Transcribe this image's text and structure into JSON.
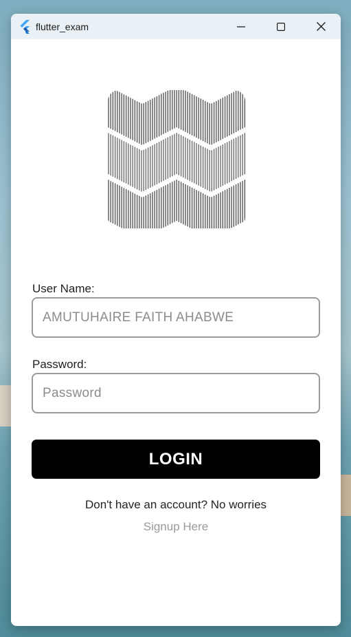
{
  "window": {
    "title": "flutter_exam",
    "icon": "flutter-logo-icon",
    "controls": [
      "minimize-icon",
      "maximize-icon",
      "close-icon"
    ]
  },
  "logo": {
    "icon": "zigzag-pattern-logo"
  },
  "form": {
    "username_label": "User Name:",
    "username_placeholder": "AMUTUHAIRE FAITH AHABWE",
    "username_value": "",
    "password_label": "Password:",
    "password_placeholder": "Password",
    "password_value": "",
    "login_label": "LOGIN"
  },
  "footer": {
    "prompt": "Don't have an account? No worries",
    "signup_link": "Signup Here"
  },
  "colors": {
    "titlebar": "#e9f1f6",
    "button": "#000000",
    "field_border": "#9a9a9a",
    "link": "#9a9a9a"
  }
}
